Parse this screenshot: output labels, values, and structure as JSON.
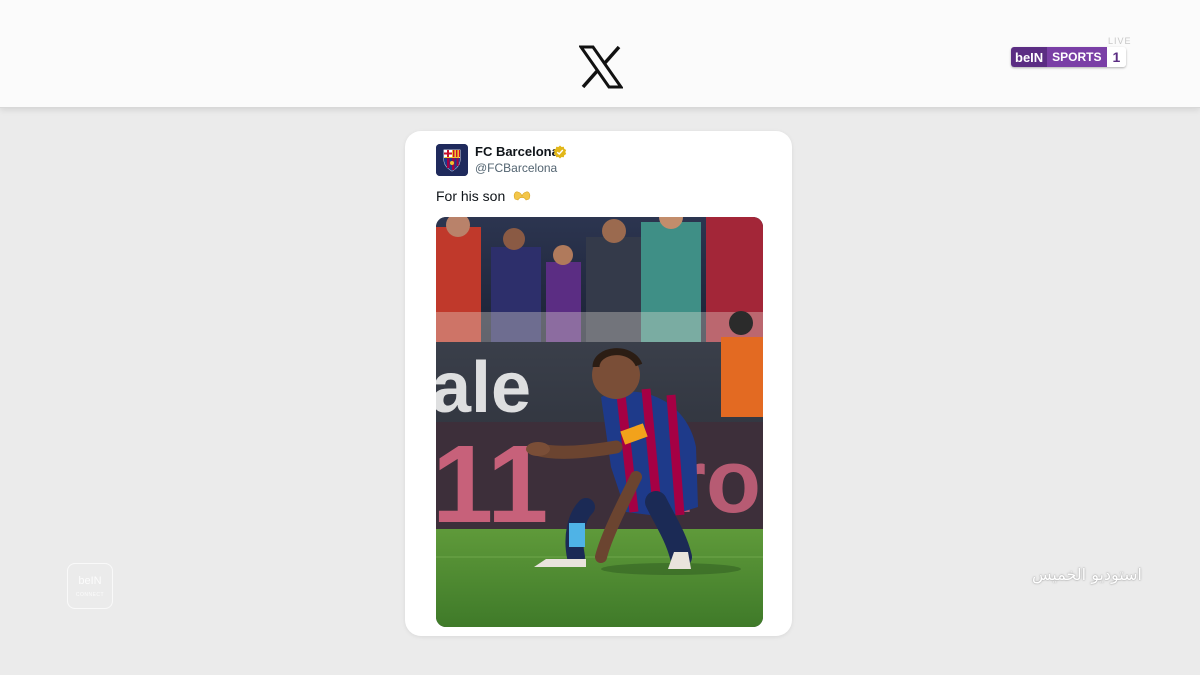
{
  "header": {
    "platform_logo": "x-logo-icon",
    "live_label": "LIVE",
    "channel": {
      "brand": "beIN",
      "name": "SPORTS",
      "number": "1"
    }
  },
  "tweet": {
    "author_name": "FC Barcelona",
    "author_handle": "@FCBarcelona",
    "verified_badge": "gold-verified-icon",
    "text": "For his son",
    "emoji": "heart-hands-icon",
    "media_alt": "Player crouching on the pitch clapping in front of the crowd"
  },
  "overlay": {
    "watermark_brand": "beIN",
    "watermark_sub": "CONNECT",
    "show_name": "استوديو الخميس"
  },
  "colors": {
    "background": "#ebebeb",
    "card": "#ffffff",
    "verified": "#e2b719",
    "bein_purple": "#5b2d83"
  }
}
